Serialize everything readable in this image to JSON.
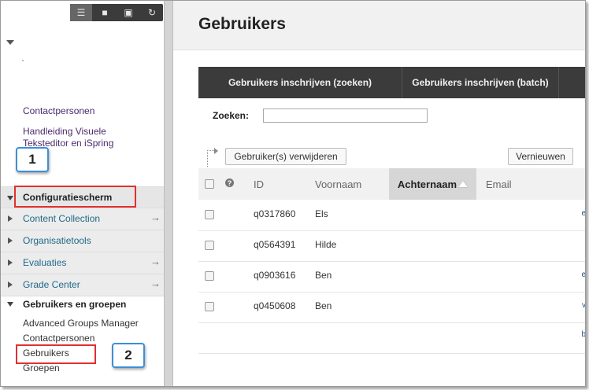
{
  "sidebar": {
    "toolbar": {
      "icons": [
        "list-icon",
        "folder-icon",
        "folder-tree-icon",
        "refresh-icon"
      ]
    },
    "links": [
      {
        "label": "Contactpersonen"
      },
      {
        "label": "Handleiding Visuele"
      },
      {
        "label": "Teksteditor en iSpring"
      }
    ],
    "control_panel": {
      "label": "Configuratiescherm",
      "items": [
        {
          "label": "Content Collection",
          "arrow": "→"
        },
        {
          "label": "Organisatietools",
          "arrow": ""
        },
        {
          "label": "Evaluaties",
          "arrow": "→"
        },
        {
          "label": "Grade Center",
          "arrow": "→"
        }
      ]
    },
    "users_groups": {
      "label": "Gebruikers en groepen",
      "items": [
        {
          "label": "Advanced Groups Manager"
        },
        {
          "label": "Contactpersonen"
        },
        {
          "label": "Gebruikers"
        },
        {
          "label": "Groepen"
        }
      ]
    }
  },
  "callouts": {
    "one": "1",
    "two": "2"
  },
  "main": {
    "title": "Gebruikers",
    "actions": [
      {
        "label": "Gebruikers inschrijven (zoeken)"
      },
      {
        "label": "Gebruikers inschrijven (batch)"
      }
    ],
    "search": {
      "label": "Zoeken:",
      "value": ""
    },
    "delete_button": "Gebruiker(s) verwijderen",
    "refresh_button": "Vernieuwen",
    "columns": {
      "id": "ID",
      "first": "Voornaam",
      "last": "Achternaam",
      "email": "Email"
    },
    "rows": [
      {
        "id": "q0317860",
        "first": "Els"
      },
      {
        "id": "q0564391",
        "first": "Hilde"
      },
      {
        "id": "q0903616",
        "first": "Ben"
      },
      {
        "id": "q0450608",
        "first": "Ben"
      }
    ],
    "edge_fragments": [
      "e",
      "e",
      "v",
      "b"
    ]
  },
  "colors": {
    "highlight": "#e03030",
    "callout_border": "#3d8fd6",
    "action_bar": "#3b3b3b"
  }
}
